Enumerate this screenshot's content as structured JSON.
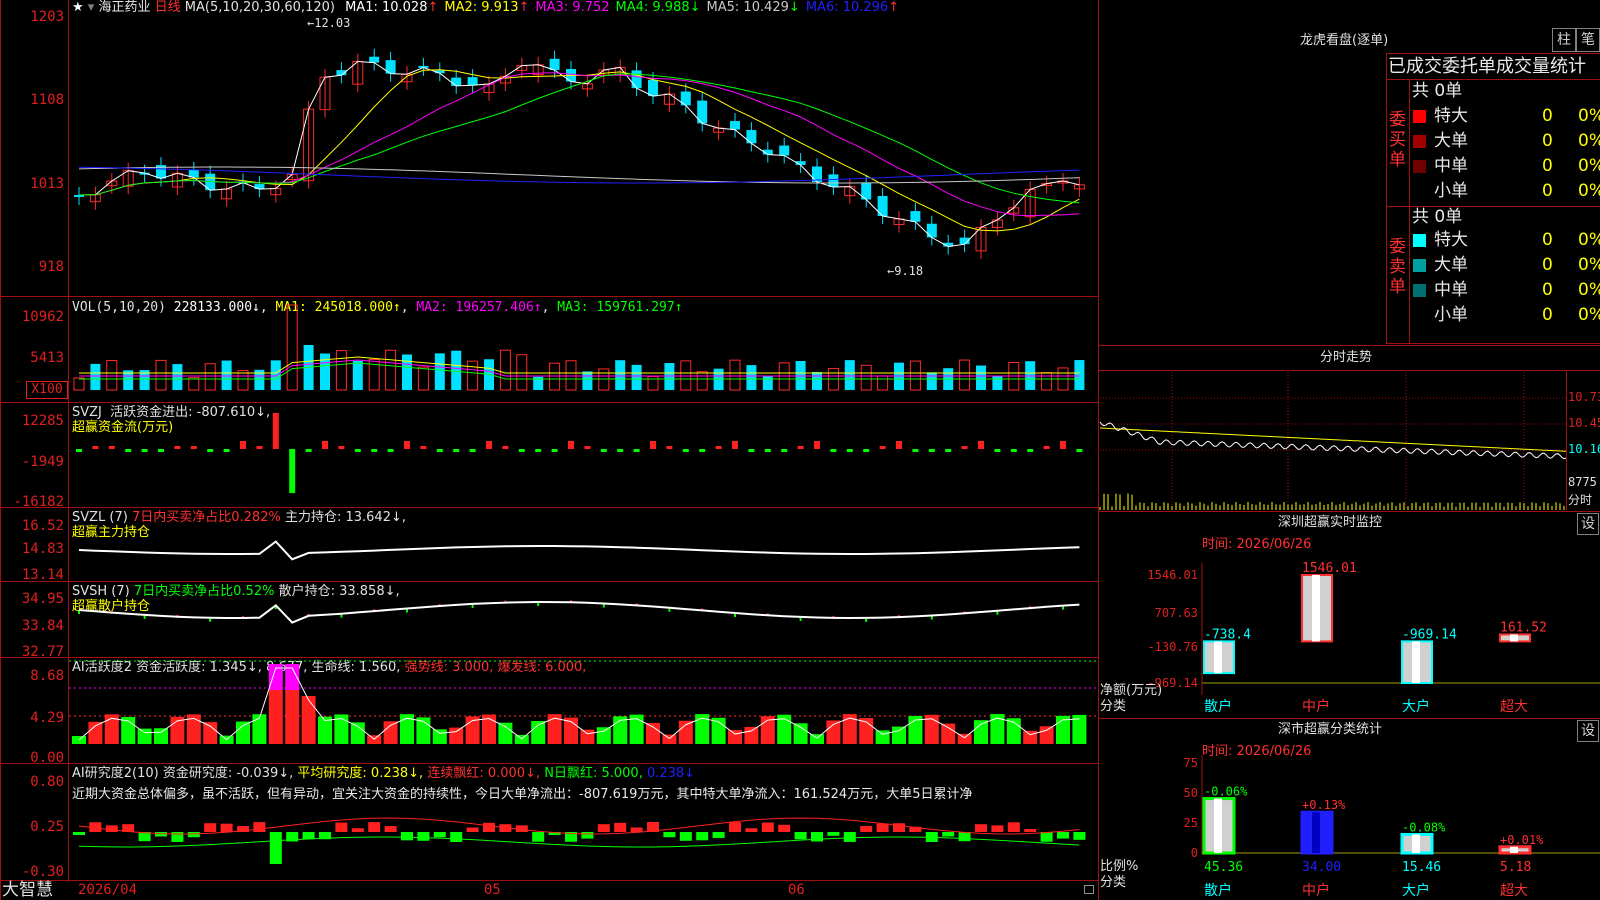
{
  "stock": {
    "name": "海正药业",
    "period": "日线",
    "star": "★"
  },
  "main": {
    "y_ticks": [
      "1203",
      "1108",
      "1013",
      "918"
    ],
    "ma_title": "MA(5,10,20,30,60,120)",
    "ma": [
      {
        "label": "MA1:",
        "value": "10.028",
        "arrow": "↑",
        "color": "#ffffff"
      },
      {
        "label": "MA2:",
        "value": "9.913",
        "arrow": "↑",
        "color": "#ffff00"
      },
      {
        "label": "MA3:",
        "value": "9.752",
        "arrow": "",
        "color": "#ff00ff"
      },
      {
        "label": "MA4:",
        "value": "9.988",
        "arrow": "↓",
        "color": "#00ff00"
      },
      {
        "label": "MA5:",
        "value": "10.429",
        "arrow": "↓",
        "color": "#c8c8c8"
      },
      {
        "label": "MA6:",
        "value": "10.296",
        "arrow": "↑",
        "color": "#2020ff"
      }
    ],
    "high_note": "12.03",
    "low_note": "9.18"
  },
  "vol": {
    "y_ticks": [
      "10962",
      "5413",
      "X100"
    ],
    "title": "VOL(5,10,20)",
    "value": "228133.000↓",
    "ma1": "MA1: 245018.000↑",
    "ma2": "MA2: 196257.406↑",
    "ma3": "MA3: 159761.297↑"
  },
  "svzj": {
    "y_ticks": [
      "12285",
      "-1949",
      "-16182"
    ],
    "title": "SVZJ",
    "text": "活跃资金进出: -807.610↓,",
    "sub": "超赢资金流(万元)"
  },
  "svzl": {
    "y_ticks": [
      "16.52",
      "14.83",
      "13.14"
    ],
    "title": "SVZL (7)",
    "ratio": "7日内买卖净占比0.282%",
    "text": "主力持仓: 13.642↓,",
    "sub": "超赢主力持仓"
  },
  "svsh": {
    "y_ticks": [
      "34.95",
      "33.84",
      "32.77"
    ],
    "title": "SVSH (7)",
    "ratio": "7日内买卖净占比0.52%",
    "text": "散户持仓: 33.858↓,",
    "sub": "超赢散户持仓"
  },
  "ai_act": {
    "y_ticks": [
      "8.68",
      "4.29",
      "0.00"
    ],
    "title": "AI活跃度2",
    "t1": "资金活跃度: 1.345↓,",
    "t2": "8.677,",
    "t3": "生命线: 1.560,",
    "t4": "强势线: 3.000,",
    "t5": "爆发线: 6.000,"
  },
  "ai_res": {
    "y_ticks": [
      "0.80",
      "0.25",
      "-0.30"
    ],
    "title": "AI研究度2(10)",
    "t1": "资金研究度: -0.039↓,",
    "t2": "平均研究度: 0.238↓,",
    "t3": "连续飘红: 0.000↓,",
    "t4": "N日飘红: 5.000,",
    "t5": "0.238↓",
    "comment": "近期大资金总体偏多，虽不活跃，但有异动，宜关注大资金的持续性，今日大单净流出：-807.619万元，其中特大单净流入：161.524万元，大单5日累计净"
  },
  "bottom": {
    "brand": "大智慧",
    "dates": [
      "2026/04",
      "05",
      "06"
    ]
  },
  "right": {
    "lhb_title": "龙虎看盘(逐单)",
    "btn_zhu": "柱",
    "btn_bi": "笔",
    "table_title": "已成交委托单成交量统计",
    "buy_label": [
      "委",
      "买",
      "单"
    ],
    "sell_label": [
      "委",
      "卖",
      "单"
    ],
    "buy_total": "共 0单",
    "sell_total": "共 0单",
    "buy_rows": [
      {
        "name": "特大",
        "count": "0",
        "pct": "0%",
        "color": "#ff0000"
      },
      {
        "name": "大单",
        "count": "0",
        "pct": "0%",
        "color": "#a00000"
      },
      {
        "name": "中单",
        "count": "0",
        "pct": "0%",
        "color": "#700000"
      },
      {
        "name": "小单",
        "count": "0",
        "pct": "0%",
        "color": "#000000"
      }
    ],
    "sell_rows": [
      {
        "name": "特大",
        "count": "0",
        "pct": "0%",
        "color": "#00ffff"
      },
      {
        "name": "大单",
        "count": "0",
        "pct": "0%",
        "color": "#00a0a0"
      },
      {
        "name": "中单",
        "count": "0",
        "pct": "0%",
        "color": "#007070"
      },
      {
        "name": "小单",
        "count": "0",
        "pct": "0%",
        "color": "#000000"
      }
    ],
    "intraday_title": "分时走势",
    "intraday_ticks": [
      "10.73",
      "10.45",
      "10.16",
      "8775",
      "分时"
    ],
    "sz_title": "深圳超赢实时监控",
    "sz_time": "时间: 2026/06/26",
    "sz_btn": "设",
    "sz_ticks": [
      "1546.01",
      "707.63",
      "-130.76",
      "-969.14"
    ],
    "sz_axis": "净额(万元)",
    "sz_axis2": "分类",
    "sz_cats": [
      "散户",
      "中户",
      "大户",
      "超大"
    ],
    "sz_vals": [
      "-738.4",
      "1546.01",
      "-969.14",
      "161.52"
    ],
    "cls_title": "深市超赢分类统计",
    "cls_time": "时间: 2026/06/26",
    "cls_btn": "设",
    "cls_ticks": [
      "75",
      "50",
      "25",
      "0"
    ],
    "cls_axis": "比例%",
    "cls_axis2": "分类",
    "cls_cats": [
      "散户",
      "中户",
      "大户",
      "超大"
    ],
    "cls_vals": [
      "45.36",
      "34.00",
      "15.46",
      "5.18"
    ],
    "cls_changes": [
      "-0.06%",
      "+0.13%",
      "-0.08%",
      "+0.01%"
    ]
  }
}
